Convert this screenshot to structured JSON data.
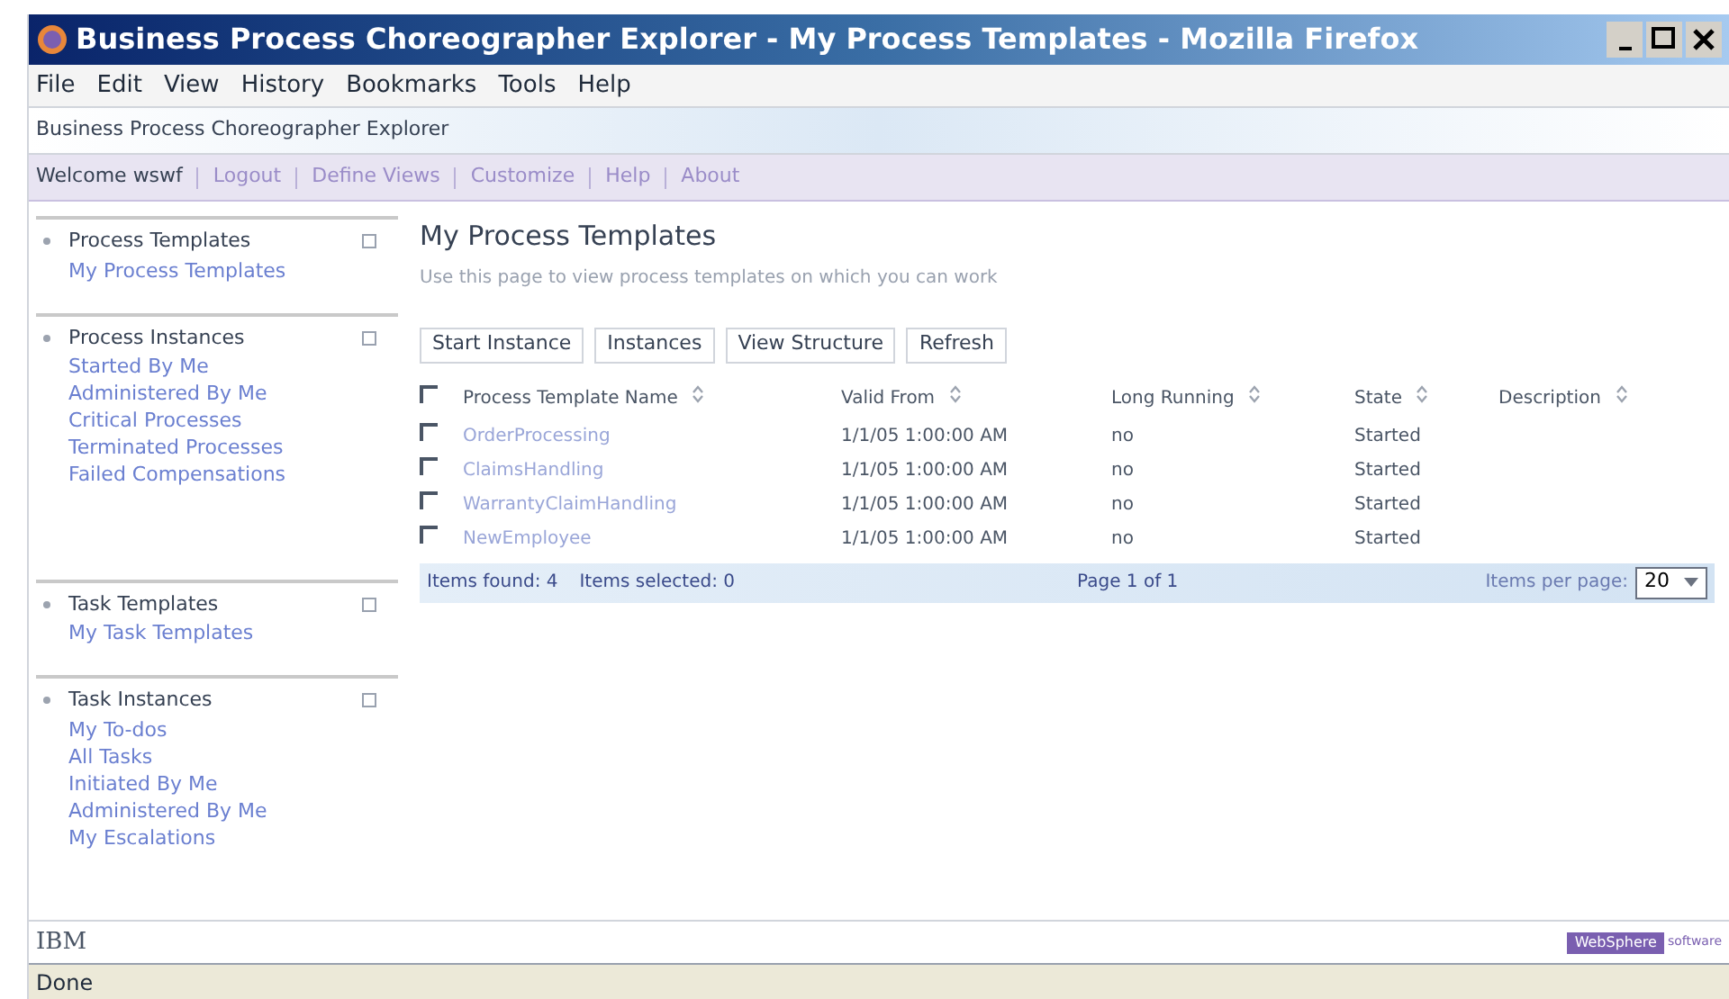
{
  "window": {
    "title": "Business Process Choreographer Explorer - My Process Templates - Mozilla Firefox"
  },
  "menu": [
    "File",
    "Edit",
    "View",
    "History",
    "Bookmarks",
    "Tools",
    "Help"
  ],
  "banner": {
    "title": "Business Process Choreographer Explorer"
  },
  "nav": {
    "welcome": "Welcome wswf",
    "links": [
      "Logout",
      "Define Views",
      "Customize",
      "Help",
      "About"
    ]
  },
  "sidebar": [
    {
      "title": "Process Templates",
      "items": [
        "My Process Templates"
      ]
    },
    {
      "title": "Process Instances",
      "items": [
        "Started By Me",
        "Administered By Me",
        "Critical Processes",
        "Terminated Processes",
        "Failed Compensations"
      ]
    },
    {
      "title": "Task Templates",
      "items": [
        "My Task Templates"
      ]
    },
    {
      "title": "Task Instances",
      "items": [
        "My To-dos",
        "All Tasks",
        "Initiated By Me",
        "Administered By Me",
        "My Escalations"
      ]
    }
  ],
  "page": {
    "title": "My Process Templates",
    "description": "Use this page to view process templates on which you can work"
  },
  "buttons": [
    "Start Instance",
    "Instances",
    "View Structure",
    "Refresh"
  ],
  "table": {
    "select_all_checked": false,
    "columns": [
      "Process Template Name",
      "Valid From",
      "Long Running",
      "State",
      "Description"
    ],
    "rows": [
      {
        "checked": false,
        "cells": [
          "OrderProcessing",
          "1/1/05 1:00:00 AM",
          "no",
          "Started"
        ]
      },
      {
        "checked": false,
        "cells": [
          "ClaimsHandling",
          "1/1/05 1:00:00 AM",
          "no",
          "Started"
        ]
      },
      {
        "checked": false,
        "cells": [
          "WarrantyClaimHandling",
          "1/1/05 1:00:00 AM",
          "no",
          "Started"
        ]
      },
      {
        "checked": false,
        "cells": [
          "NewEmployee",
          "1/1/05 1:00:00 AM",
          "no",
          "Started"
        ]
      }
    ]
  },
  "pager": {
    "found": "Items found: 4",
    "selected": "Items selected: 0",
    "page": "Page 1 of 1",
    "per_page_label": "Items per page:",
    "per_page": "20"
  },
  "footer": {
    "brand": "IBM",
    "product": "WebSphere",
    "product_suffix": "software"
  },
  "status_bar": "Done"
}
